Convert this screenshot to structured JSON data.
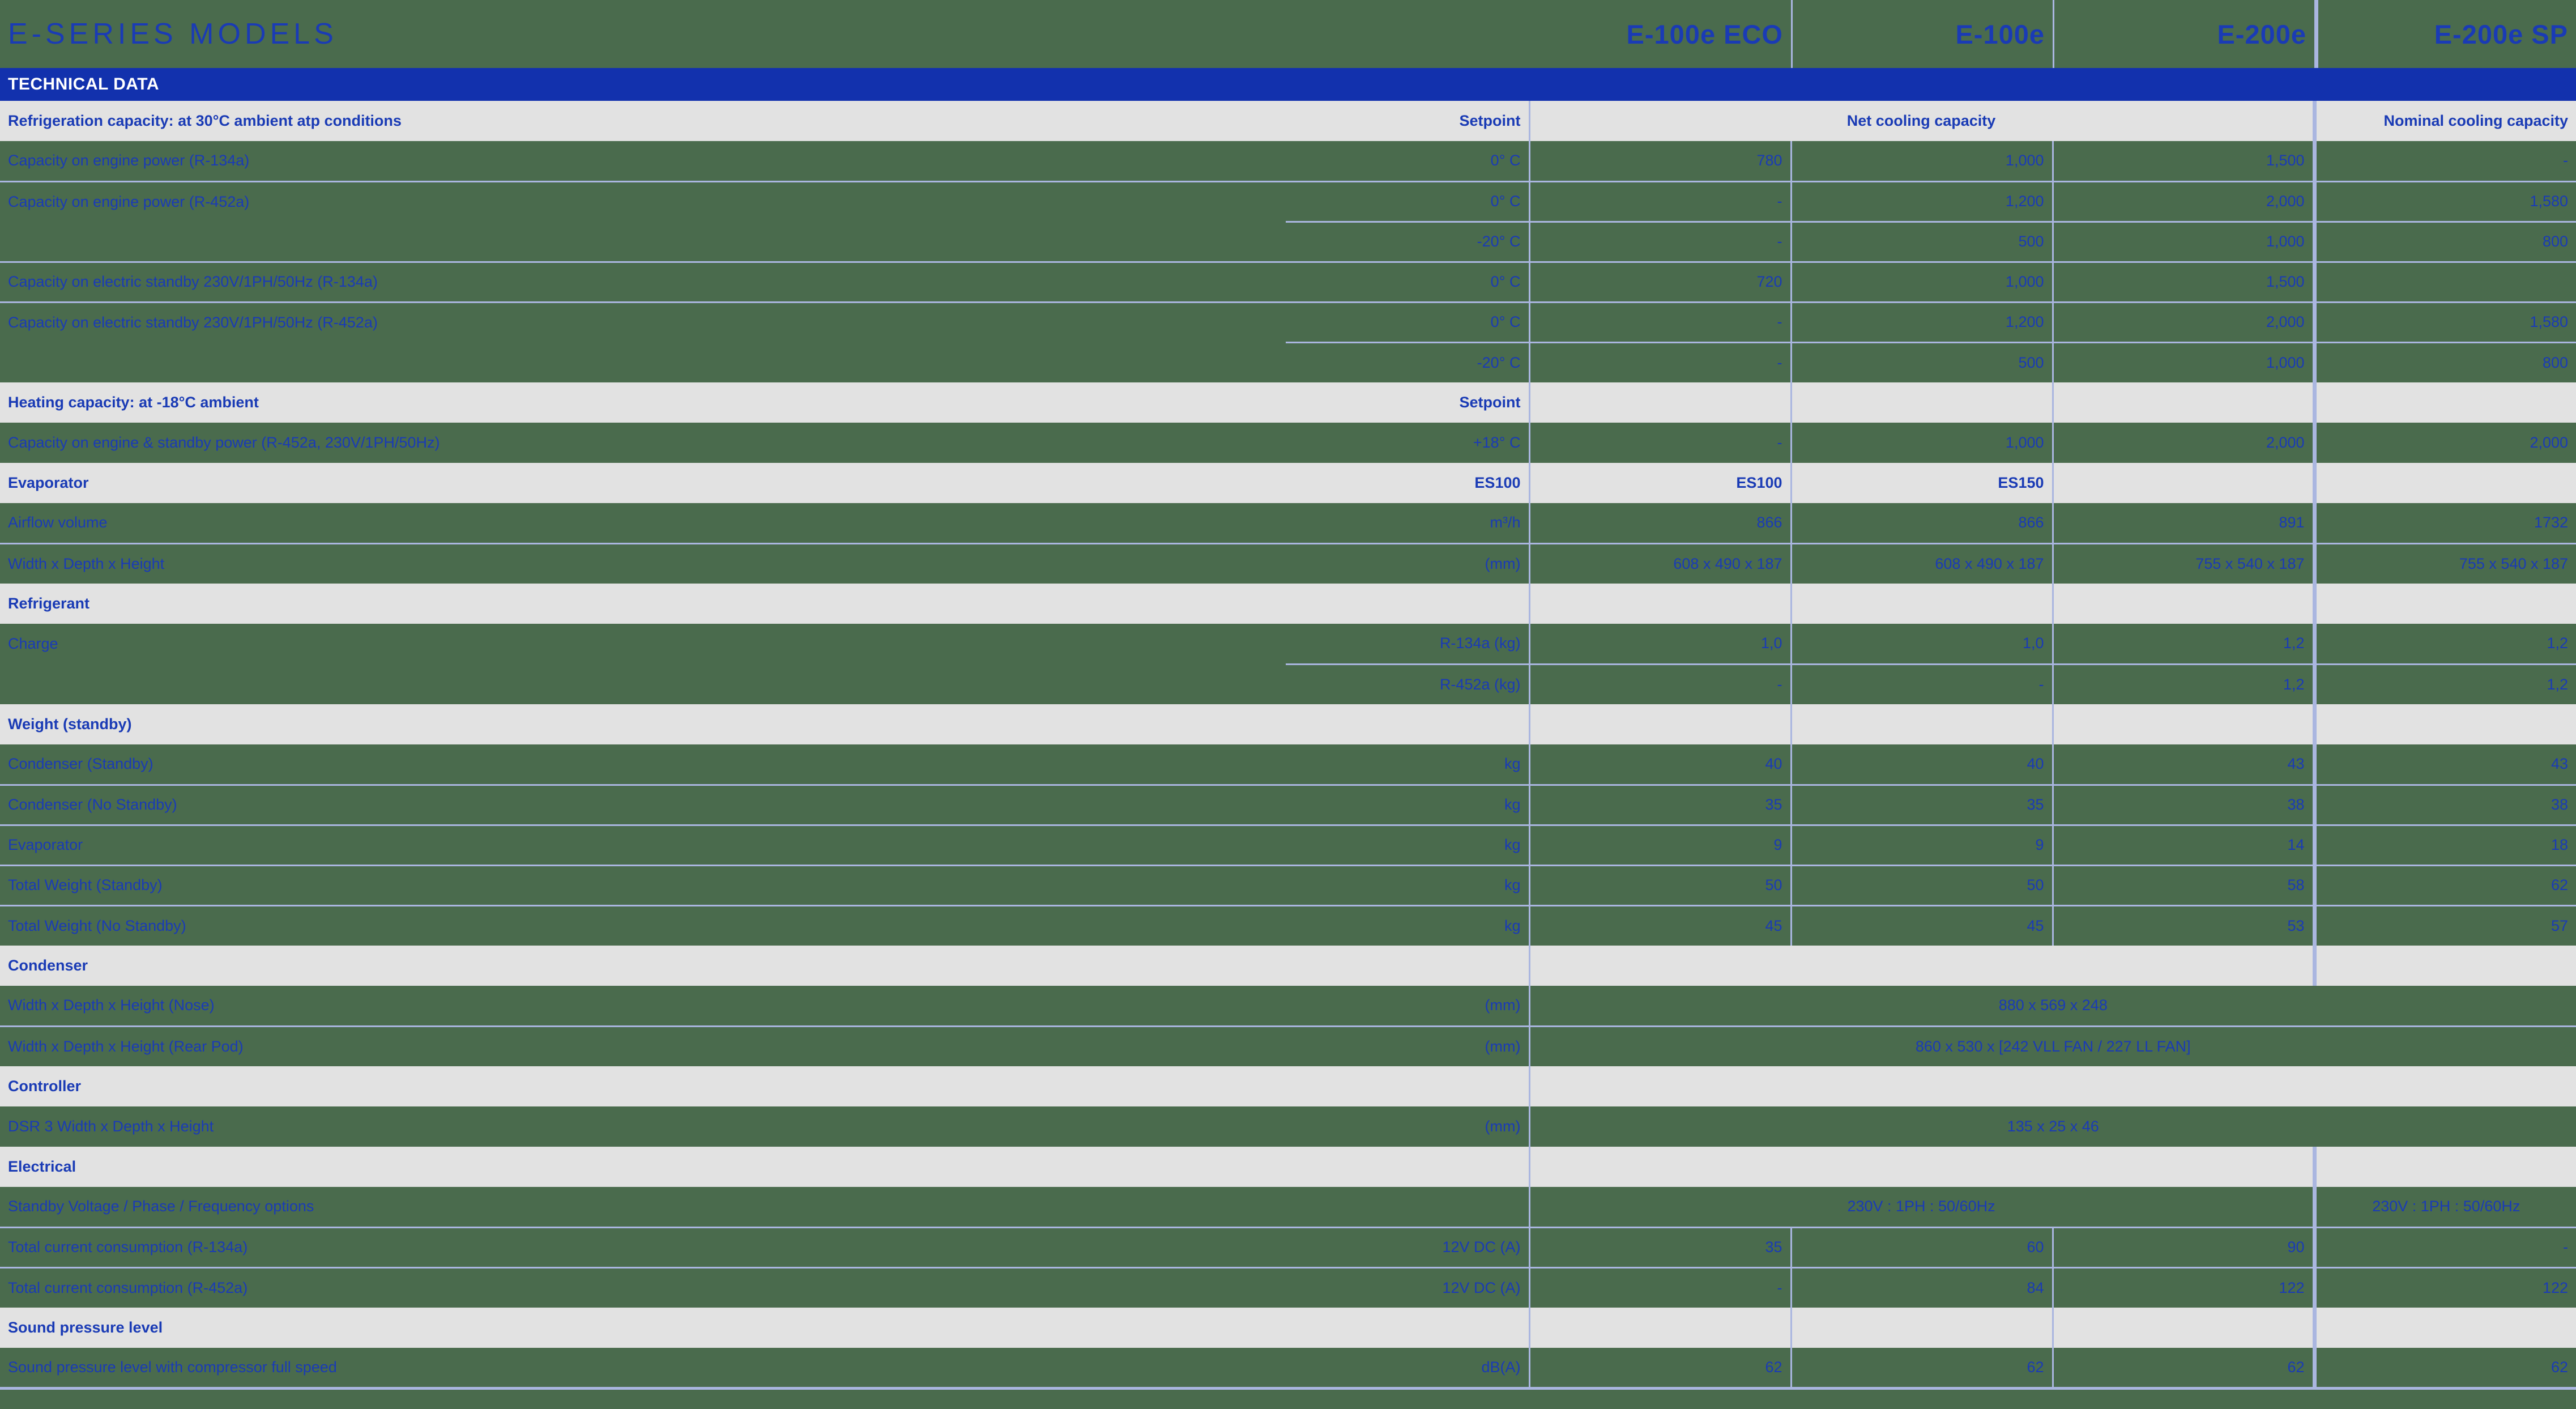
{
  "header": {
    "title": "E-SERIES MODELS",
    "models": [
      "E-100e ECO",
      "E-100e",
      "E-200e",
      "E-200e SP"
    ]
  },
  "band": {
    "label": "TECHNICAL DATA"
  },
  "sections": {
    "refrigeration": {
      "title": "Refrigeration capacity: at 30°C ambient atp conditions",
      "unit_header": "Setpoint",
      "net_cooling_header": "Net cooling capacity",
      "nominal_cooling_header": "Nominal cooling capacity"
    },
    "heating": {
      "title": "Heating capacity: at -18°C ambient",
      "unit_header": "Setpoint"
    },
    "evaporator": {
      "title": "Evaporator",
      "models": [
        "ES100",
        "ES100",
        "ES150",
        ""
      ]
    },
    "refrigerant": {
      "title": "Refrigerant"
    },
    "weight": {
      "title": "Weight (standby)"
    },
    "condenser": {
      "title": "Condenser"
    },
    "controller": {
      "title": "Controller"
    },
    "electrical": {
      "title": "Electrical"
    },
    "sound": {
      "title": "Sound pressure level"
    }
  },
  "rows": {
    "cap_engine_134a": {
      "label": "Capacity on engine power (R-134a)",
      "unit": "0° C",
      "values": [
        "780",
        "1,000",
        "1,500",
        "-"
      ]
    },
    "cap_engine_452a_0": {
      "label": "Capacity on engine power (R-452a)",
      "unit": "0° C",
      "values": [
        "-",
        "1,200",
        "2,000",
        "1,580"
      ]
    },
    "cap_engine_452a_m20": {
      "label": "",
      "unit": "-20° C",
      "values": [
        "-",
        "500",
        "1,000",
        "800"
      ]
    },
    "cap_standby_134a": {
      "label": "Capacity on electric standby 230V/1PH/50Hz (R-134a)",
      "unit": "0° C",
      "values": [
        "720",
        "1,000",
        "1,500",
        ""
      ]
    },
    "cap_standby_452a_0": {
      "label": "Capacity on electric standby 230V/1PH/50Hz (R-452a)",
      "unit": "0° C",
      "values": [
        "-",
        "1,200",
        "2,000",
        "1,580"
      ]
    },
    "cap_standby_452a_m20": {
      "label": "",
      "unit": "-20° C",
      "values": [
        "-",
        "500",
        "1,000",
        "800"
      ]
    },
    "heating_capacity": {
      "label": "Capacity on engine & standby power (R-452a, 230V/1PH/50Hz)",
      "unit": "+18° C",
      "values": [
        "-",
        "1,000",
        "2,000",
        "2,000"
      ]
    },
    "airflow": {
      "label": "Airflow volume",
      "unit": "m³/h",
      "values": [
        "866",
        "866",
        "891",
        "1732"
      ]
    },
    "evap_dims": {
      "label": "Width x Depth x Height",
      "unit": "(mm)",
      "values": [
        "608 x 490 x 187",
        "608 x 490 x 187",
        "755 x 540 x 187",
        "755 x 540 x 187"
      ]
    },
    "charge_134a": {
      "label": "Charge",
      "unit": "R-134a (kg)",
      "values": [
        "1,0",
        "1,0",
        "1,2",
        "1,2"
      ]
    },
    "charge_452a": {
      "label": "",
      "unit": "R-452a (kg)",
      "values": [
        "-",
        "-",
        "1,2",
        "1,2"
      ]
    },
    "cond_standby": {
      "label": "Condenser (Standby)",
      "unit": "kg",
      "values": [
        "40",
        "40",
        "43",
        "43"
      ]
    },
    "cond_no_standby": {
      "label": "Condenser (No Standby)",
      "unit": "kg",
      "values": [
        "35",
        "35",
        "38",
        "38"
      ]
    },
    "evap_weight": {
      "label": "Evaporator",
      "unit": "kg",
      "values": [
        "9",
        "9",
        "14",
        "18"
      ]
    },
    "total_standby": {
      "label": "Total Weight (Standby)",
      "unit": "kg",
      "values": [
        "50",
        "50",
        "58",
        "62"
      ]
    },
    "total_no_standby": {
      "label": "Total Weight (No Standby)",
      "unit": "kg",
      "values": [
        "45",
        "45",
        "53",
        "57"
      ]
    },
    "cond_nose": {
      "label": "Width x Depth x Height (Nose)",
      "unit": "(mm)",
      "value_span": "880 x 569 x 248"
    },
    "cond_rear_pod": {
      "label": "Width x Depth x Height (Rear Pod)",
      "unit": "(mm)",
      "value_span": "860 x 530 x [242 VLL FAN / 227 LL FAN]"
    },
    "dsr3": {
      "label": "DSR 3 Width x Depth x Height",
      "unit": "(mm)",
      "value_span": "135 x 25 x 46"
    },
    "standby_voltage": {
      "label": "Standby Voltage / Phase / Frequency options",
      "unit": "",
      "value_span_123": "230V : 1PH : 50/60Hz",
      "value_m4": "230V : 1PH : 50/60Hz"
    },
    "current_134a": {
      "label": "Total current consumption (R-134a)",
      "unit": "12V DC (A)",
      "values": [
        "35",
        "60",
        "90",
        "-"
      ]
    },
    "current_452a": {
      "label": "Total current consumption (R-452a)",
      "unit": "12V DC (A)",
      "values": [
        "-",
        "84",
        "122",
        "122"
      ]
    },
    "sound_level": {
      "label": "Sound pressure level with compressor full speed",
      "unit": "dB(A)",
      "values": [
        "62",
        "62",
        "62",
        "62"
      ]
    }
  },
  "colors": {
    "background_green": "#4a6b4d",
    "accent_blue": "#1231ad",
    "text_blue": "#1a3bb5",
    "section_grey": "#e2e2e2",
    "rule_light_blue": "#aab6e0"
  }
}
